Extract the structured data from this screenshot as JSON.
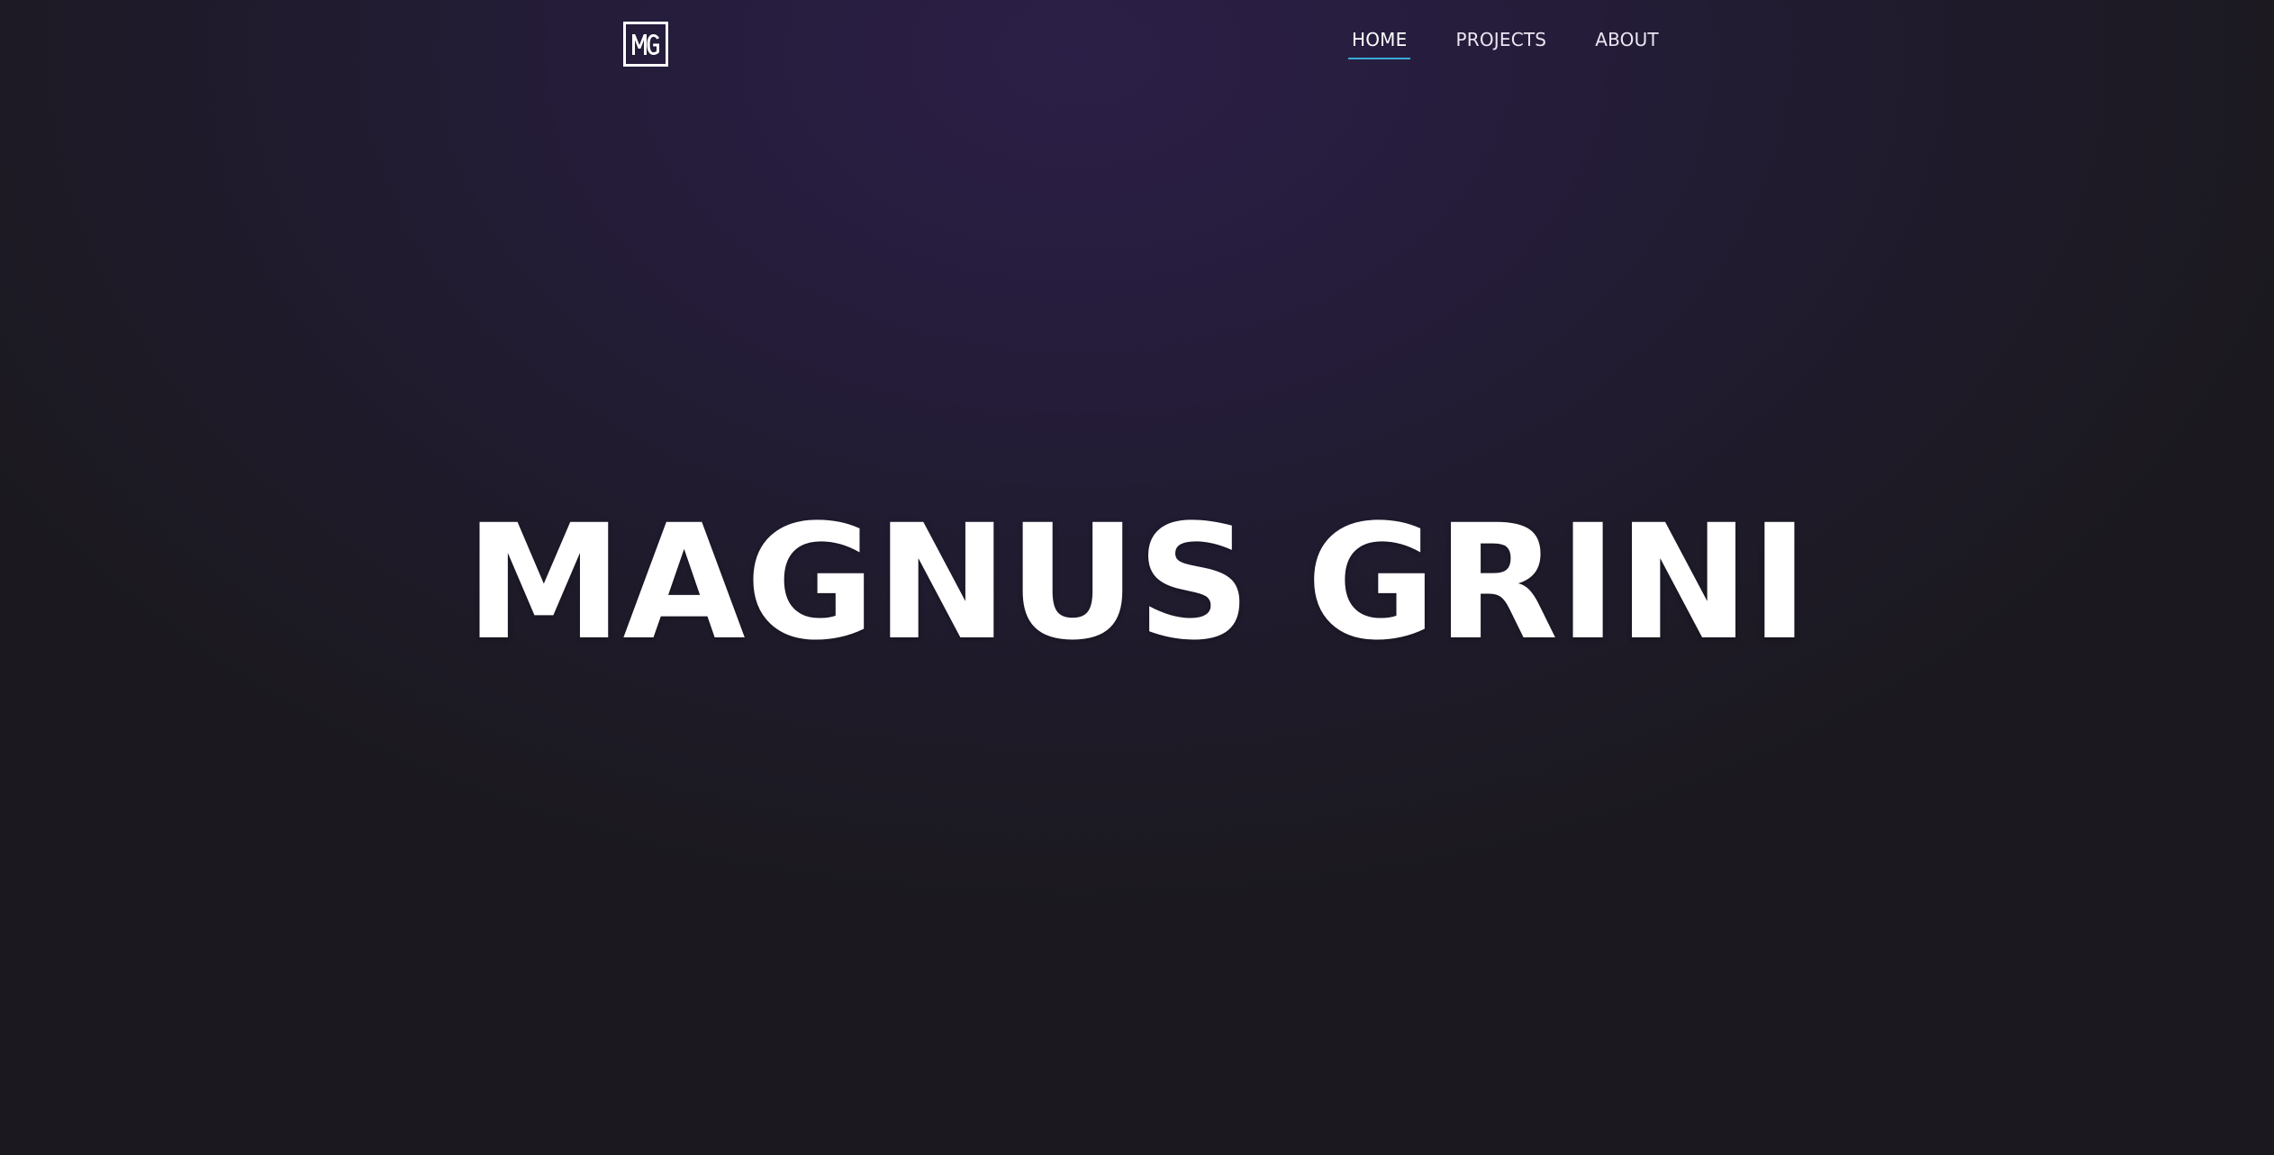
{
  "brand": {
    "logo_text": "MG",
    "logo_icon": "mg-monogram-icon"
  },
  "nav": {
    "items": [
      {
        "label": "HOME",
        "active": true
      },
      {
        "label": "PROJECTS",
        "active": false
      },
      {
        "label": "ABOUT",
        "active": false
      }
    ]
  },
  "hero": {
    "title": "MAGNUS GRINI"
  },
  "colors": {
    "background_top": "#2c1f47",
    "background_bottom": "#1b191f",
    "text": "#ffffff",
    "nav_underline": "#3aa8d6"
  }
}
